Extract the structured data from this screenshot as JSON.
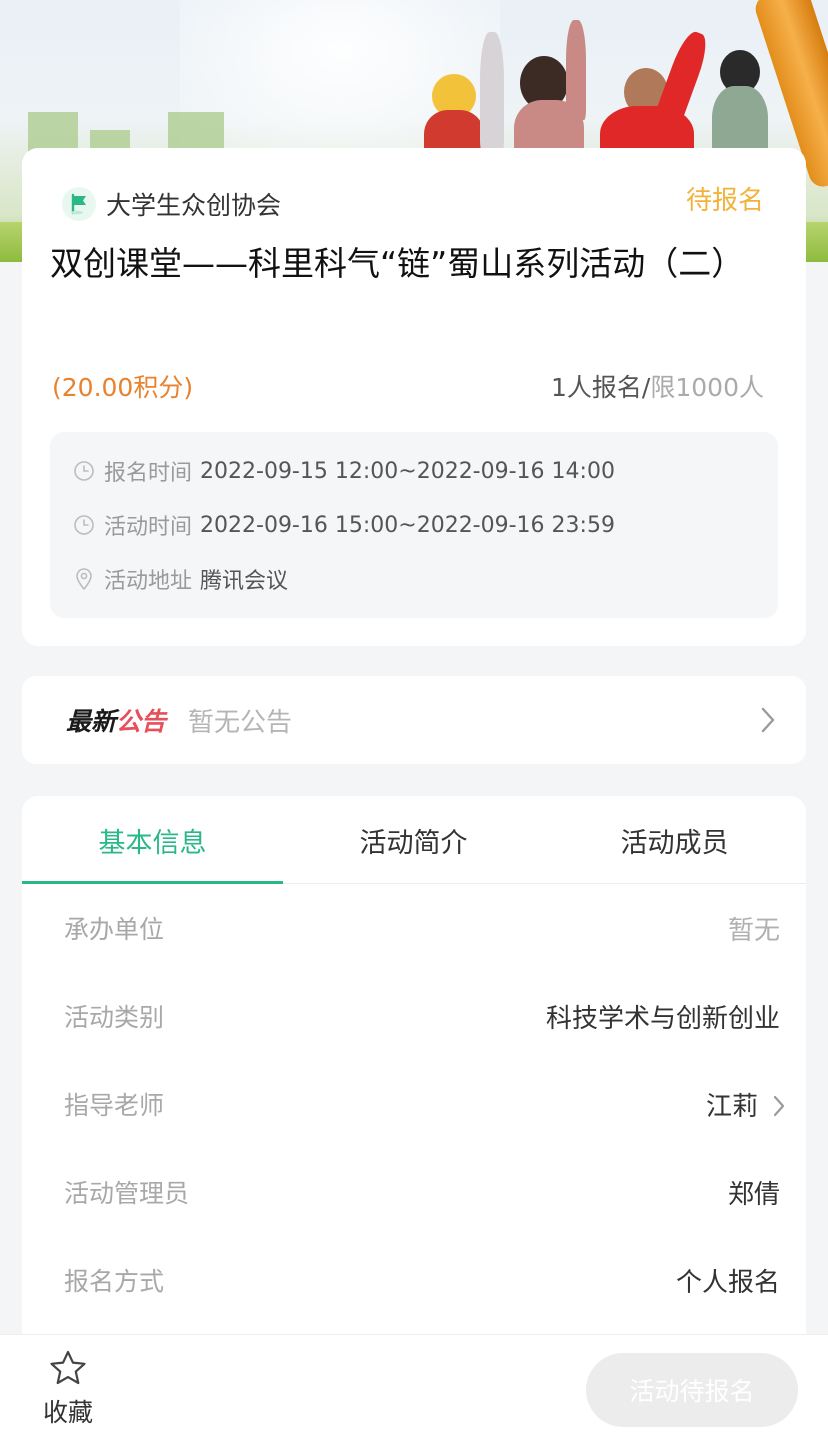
{
  "activity": {
    "organizer": "大学生众创协会",
    "status": "待报名",
    "title": "双创课堂——科里科气“链”蜀山系列活动（二）",
    "credits": "(20.00积分)",
    "signup_count": "1人报名/",
    "signup_limit": "限1000人",
    "info": {
      "signup_time_label": "报名时间",
      "signup_time": "2022-09-15 12:00~2022-09-16 14:00",
      "activity_time_label": "活动时间",
      "activity_time": "2022-09-16 15:00~2022-09-16 23:59",
      "address_label": "活动地址",
      "address": "腾讯会议"
    }
  },
  "notice": {
    "title_part1": "最新",
    "title_part2": "公告",
    "text": "暂无公告"
  },
  "tabs": [
    {
      "label": "基本信息",
      "active": true
    },
    {
      "label": "活动简介",
      "active": false
    },
    {
      "label": "活动成员",
      "active": false
    }
  ],
  "basic_info": [
    {
      "label": "承办单位",
      "value": "暂无"
    },
    {
      "label": "活动类别",
      "value": "科技学术与创新创业"
    },
    {
      "label": "指导老师",
      "value": "江莉"
    },
    {
      "label": "活动管理员",
      "value": "郑倩"
    },
    {
      "label": "报名方式",
      "value": "个人报名"
    }
  ],
  "bottom_bar": {
    "favorite_label": "收藏",
    "action_label": "活动待报名"
  },
  "colors": {
    "accent": "#2bb889",
    "status": "#f2b33a",
    "credits": "#e8822c",
    "notice_red": "#e5505a"
  },
  "icons": [
    "flag-icon",
    "clock-icon",
    "location-pin-icon",
    "chevron-right-icon",
    "star-icon"
  ]
}
